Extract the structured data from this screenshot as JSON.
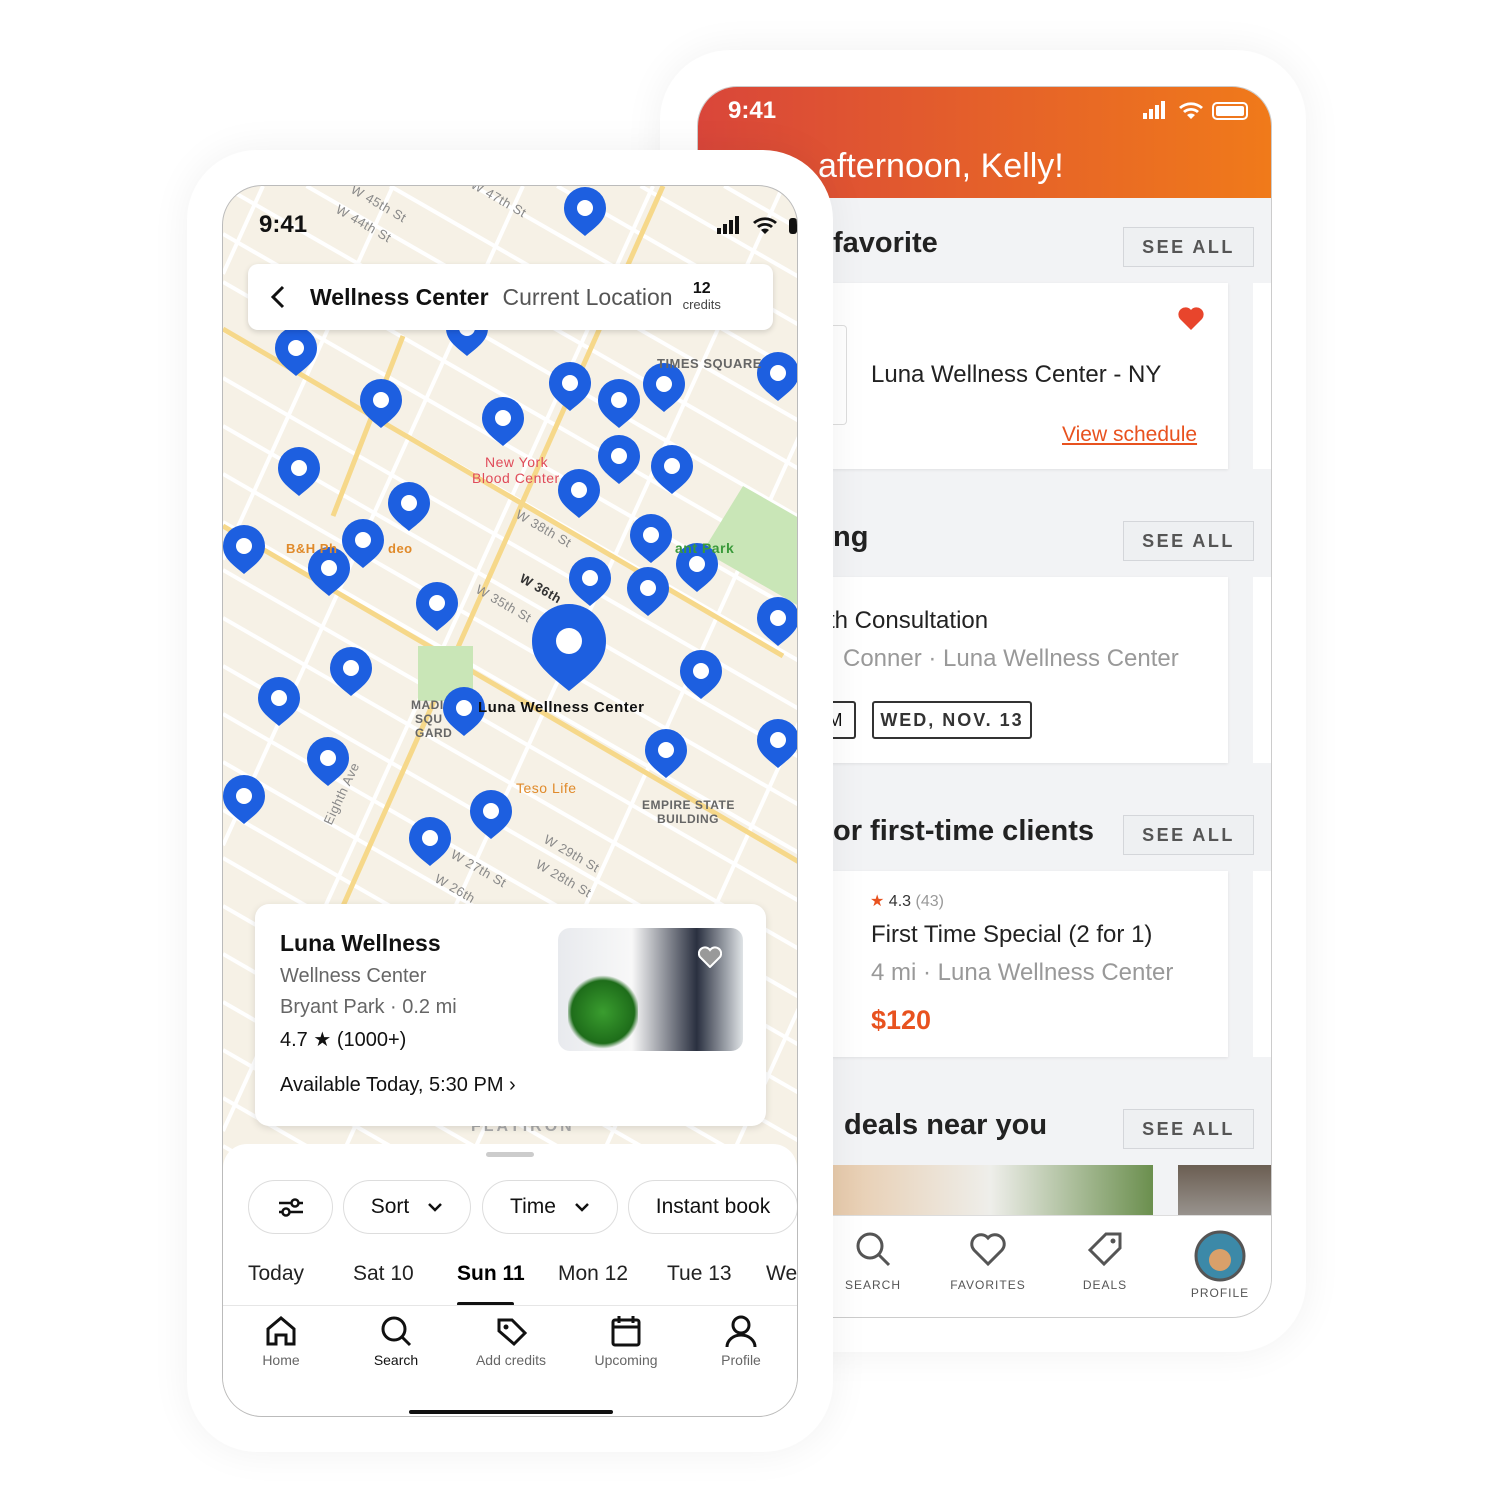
{
  "back_phone": {
    "status_time": "9:41",
    "greeting": "afternoon, Kelly!",
    "sections": [
      {
        "title": "favorite",
        "see_all": "SEE ALL"
      },
      {
        "title": "ng",
        "see_all": "SEE ALL"
      },
      {
        "title": "or first-time clients",
        "see_all": "SEE ALL"
      },
      {
        "title": "deals near you",
        "see_all": "SEE ALL"
      }
    ],
    "favorite_card": {
      "name": "Luna Wellness Center - NY",
      "link": "View schedule",
      "heart_color": "#e8452c"
    },
    "upcoming_card": {
      "title": "th Consultation",
      "subtitle": "Conner · Luna Wellness Center",
      "time_tag": "M",
      "date_tag": "WED, NOV. 13"
    },
    "intro_card": {
      "rating": "4.3",
      "reviews": "(43)",
      "title": "First Time Special (2 for 1)",
      "subtitle": "4 mi · Luna Wellness Center",
      "price": "$120"
    },
    "tabs": [
      {
        "label": "SEARCH",
        "icon": "search-icon"
      },
      {
        "label": "FAVORITES",
        "icon": "heart-icon"
      },
      {
        "label": "DEALS",
        "icon": "tag-icon"
      },
      {
        "label": "PROFILE",
        "icon": "avatar"
      }
    ],
    "accent": "#e8521f"
  },
  "front_phone": {
    "status_time": "9:41",
    "search": {
      "title": "Wellness Center",
      "location": "Current Location",
      "credits_count": "12",
      "credits_label": "credits"
    },
    "map_labels": {
      "times_square": "TIMES SQUARE",
      "blood1": "New York",
      "blood2": "Blood Center",
      "bh": "B&H Ph",
      "video": "deo",
      "park": "ant Park",
      "selected": "Luna Wellness Center",
      "teso": "Teso Life",
      "esb1": "EMPIRE STATE",
      "esb2": "BUILDING",
      "msg1": "MADI",
      "msg2": "SQU",
      "msg3": "GARD",
      "flatiron": "FLATIRON",
      "st_45": "W 45th St",
      "st_44": "W 44th St",
      "st_47": "W 47th St",
      "st_38": "W 38th St",
      "st_35": "W 35th St",
      "st_36": "W 36th",
      "st_27": "W 27th St",
      "st_26": "W 26th",
      "st_29": "W 29th St",
      "st_28": "W 28th St",
      "eighth": "Eighth Ave"
    },
    "pin_color": "#1d5fe0",
    "place_card": {
      "name": "Luna Wellness",
      "category": "Wellness Center",
      "location": "Bryant Park · 0.2 mi",
      "rating": "4.7 ★ (1000+)",
      "availability": "Available Today, 5:30 PM"
    },
    "filters": {
      "sort": "Sort",
      "time": "Time",
      "instant": "Instant book"
    },
    "days": [
      "Today",
      "Sat 10",
      "Sun 11",
      "Mon 12",
      "Tue 13",
      "We"
    ],
    "selected_day": "Sun 11",
    "nav": [
      {
        "label": "Home",
        "icon": "home-icon"
      },
      {
        "label": "Search",
        "icon": "search-icon"
      },
      {
        "label": "Add credits",
        "icon": "tag-icon"
      },
      {
        "label": "Upcoming",
        "icon": "calendar-icon"
      },
      {
        "label": "Profile",
        "icon": "profile-icon"
      }
    ],
    "active_nav": "Search"
  }
}
